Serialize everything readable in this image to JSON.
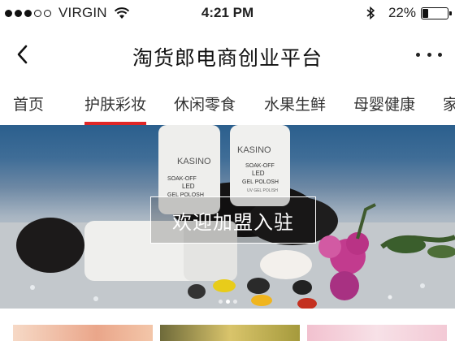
{
  "status_bar": {
    "carrier": "VIRGIN",
    "time": "4:21 PM",
    "battery": "22%",
    "icons": [
      "signal-dots-icon",
      "wifi-icon",
      "bluetooth-icon",
      "battery-icon"
    ]
  },
  "nav": {
    "title": "淘货郎电商创业平台",
    "back_icon": "back-chevron-icon",
    "more_icon": "more-dots-icon"
  },
  "tabs": [
    {
      "label": "首页",
      "active": false
    },
    {
      "label": "护肤彩妆",
      "active": true
    },
    {
      "label": "休闲零食",
      "active": false
    },
    {
      "label": "水果生鲜",
      "active": false
    },
    {
      "label": "母婴健康",
      "active": false
    },
    {
      "label": "家",
      "active": false
    }
  ],
  "banner": {
    "cta_label": "欢迎加盟入驻",
    "bottle_brand": "KASINO",
    "bottle_label": [
      "SOAK-OFF",
      "LED",
      "GEL POLOSH",
      "UV GEL POLISH"
    ],
    "page_count": 3,
    "active_page": 2
  },
  "colors": {
    "accent": "#e02727",
    "banner_top": "#2b5f8d"
  }
}
